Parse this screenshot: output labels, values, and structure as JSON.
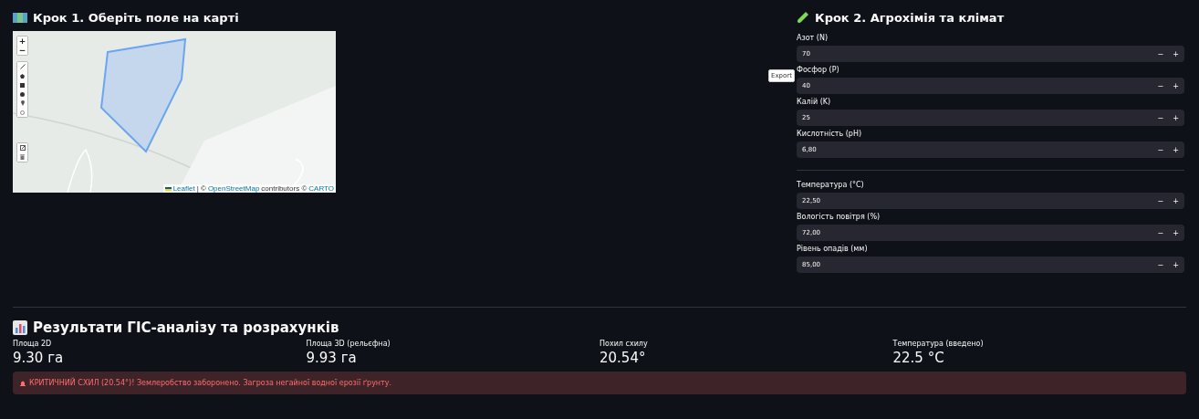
{
  "step1": {
    "title": "Крок 1. Оберіть поле на карті",
    "map": {
      "zoom_in": "+",
      "zoom_out": "−",
      "attribution": {
        "leaflet": "Leaflet",
        "separator": "| ©",
        "osm": "OpenStreetMap",
        "contributors": "contributors ©",
        "carto": "CARTO"
      }
    }
  },
  "export_button": "Export",
  "step2": {
    "title": "Крок 2. Агрохімія та клімат",
    "groups": [
      [
        {
          "label": "Азот (N)",
          "value": "70"
        },
        {
          "label": "Фосфор (P)",
          "value": "40"
        },
        {
          "label": "Калій (K)",
          "value": "25"
        },
        {
          "label": "Кислотність (pH)",
          "value": "6,80"
        }
      ],
      [
        {
          "label": "Температура (°C)",
          "value": "22,50"
        },
        {
          "label": "Вологість повітря (%)",
          "value": "72,00"
        },
        {
          "label": "Рівень опадів (мм)",
          "value": "85,00"
        }
      ]
    ],
    "minus": "−",
    "plus": "+"
  },
  "results": {
    "title": "Результати ГІС-аналізу та розрахунків",
    "metrics": [
      {
        "label": "Площа 2D",
        "value": "9.30 га"
      },
      {
        "label": "Площа 3D (рельєфна)",
        "value": "9.93 га"
      },
      {
        "label": "Похил схилу",
        "value": "20.54°"
      },
      {
        "label": "Температура (введено)",
        "value": "22.5 °C"
      }
    ],
    "alert": {
      "kind": "error",
      "text": "КРИТИЧНИЙ СХИЛ (20.54°)! Землеробство заборонено. Загроза негайної водної ерозії ґрунту."
    }
  }
}
